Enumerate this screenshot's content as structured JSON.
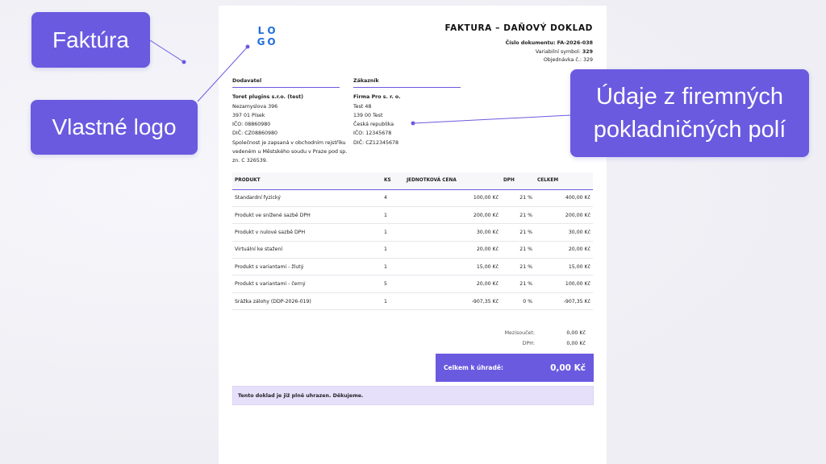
{
  "callouts": {
    "invoice": "Faktúra",
    "custom_logo": "Vlastné logo",
    "fields_line1": "Údaje z firemných",
    "fields_line2": "pokladničných polí"
  },
  "logo": [
    "L",
    "O",
    "G",
    "O"
  ],
  "document": {
    "title": "FAKTURA – DAŇOVÝ DOKLAD",
    "doc_number_label": "Číslo dokumentu:",
    "doc_number": "FA-2026-038",
    "var_symbol_label": "Variabilní symbol:",
    "var_symbol": "329",
    "order_label": "Objednávka č.:",
    "order": "329"
  },
  "supplier": {
    "heading": "Dodavatel",
    "name": "Toret plugins s.r.o. (test)",
    "street": "Nezamyslova 396",
    "city": "397 01 Písek",
    "ico": "IČO: 08860980",
    "dic": "DIČ: CZ08860980",
    "reg1": "Společnost je zapsaná v obchodním rejstříku",
    "reg2": "vedeném u Městského soudu v Praze pod sp.",
    "reg3": "zn. C 326539."
  },
  "customer": {
    "heading": "Zákazník",
    "name": "Firma Pro s. r. o.",
    "street": "Test 48",
    "city": "139 00 Test",
    "country": "Česká republika",
    "ico": "IČO: 12345678",
    "dic": "DIČ: CZ12345678"
  },
  "table": {
    "headers": [
      "PRODUKT",
      "KS",
      "JEDNOTKOVÁ CENA",
      "DPH",
      "CELKEM"
    ],
    "rows": [
      [
        "Standardní fyzický",
        "4",
        "100,00 Kč",
        "21 %",
        "400,00 Kč"
      ],
      [
        "Produkt ve snížené sazbě DPH",
        "1",
        "200,00 Kč",
        "21 %",
        "200,00 Kč"
      ],
      [
        "Produkt v nulové sazbě DPH",
        "1",
        "30,00 Kč",
        "21 %",
        "30,00 Kč"
      ],
      [
        "Virtuální ke stažení",
        "1",
        "20,00 Kč",
        "21 %",
        "20,00 Kč"
      ],
      [
        "Produkt s variantami - žlutý",
        "1",
        "15,00 Kč",
        "21 %",
        "15,00 Kč"
      ],
      [
        "Produkt s variantami - černý",
        "5",
        "20,00 Kč",
        "21 %",
        "100,00 Kč"
      ],
      [
        "Srážka zálohy (DDP-2026-019)",
        "1",
        "-907,35 Kč",
        "0 %",
        "-907,35 Kč"
      ]
    ]
  },
  "summary": {
    "subtotal_label": "Mezisoučet:",
    "subtotal": "0,00 Kč",
    "vat_label": "DPH:",
    "vat": "0,00 Kč",
    "total_label": "Celkem k úhradě:",
    "total": "0,00 Kč"
  },
  "paid_note": "Tento doklad je již plně uhrazen. Děkujeme.",
  "colors": {
    "accent": "#6a5ae0",
    "logo_blue": "#1e6fd9",
    "paid_bg": "#e7e0fb"
  }
}
